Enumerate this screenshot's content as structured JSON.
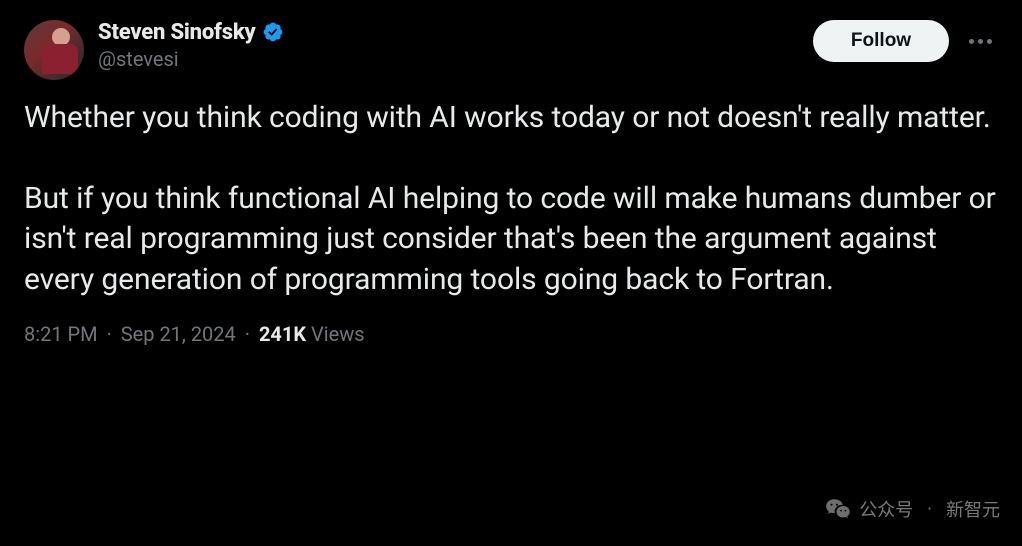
{
  "user": {
    "display_name": "Steven Sinofsky",
    "handle": "@stevesi"
  },
  "actions": {
    "follow_label": "Follow"
  },
  "tweet": {
    "paragraph1": "Whether you think coding with AI works today or not doesn't really matter.",
    "paragraph2": "But if you think functional AI helping to code will make humans dumber or isn't real programming just consider that's been the argument against every generation of programming tools going back to Fortran."
  },
  "meta": {
    "time": "8:21 PM",
    "date": "Sep 21, 2024",
    "views_count": "241K",
    "views_label": "Views"
  },
  "watermark": {
    "label": "公众号",
    "source": "新智元"
  }
}
